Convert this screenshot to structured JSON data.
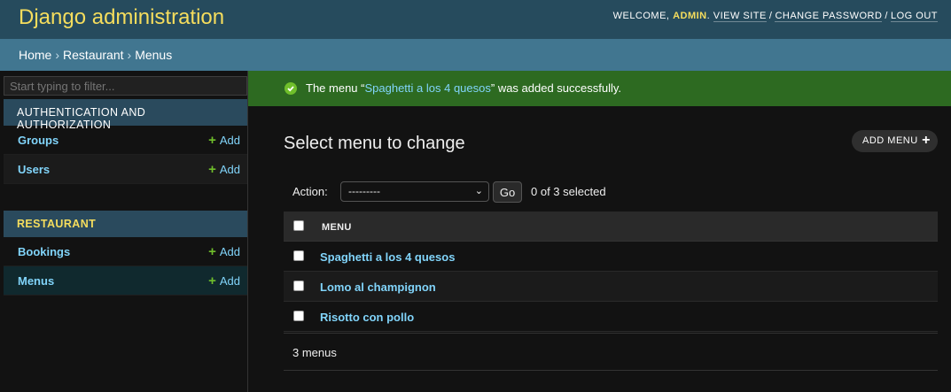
{
  "header": {
    "title": "Django administration",
    "welcome": "Welcome,",
    "username": "admin",
    "view_site": "View site",
    "change_password": "Change password",
    "log_out": "Log out",
    "separator": "/"
  },
  "breadcrumbs": {
    "home": "Home",
    "app": "Restaurant",
    "current": "Menus",
    "separator": "›"
  },
  "sidebar": {
    "filter_placeholder": "Start typing to filter...",
    "modules": [
      {
        "caption": "Authentication and Authorization",
        "models": [
          {
            "name": "Groups",
            "add": "Add"
          },
          {
            "name": "Users",
            "add": "Add"
          }
        ]
      },
      {
        "caption": "Restaurant",
        "models": [
          {
            "name": "Bookings",
            "add": "Add"
          },
          {
            "name": "Menus",
            "add": "Add"
          }
        ]
      }
    ]
  },
  "message": {
    "prefix": "The menu “",
    "link": "Spaghetti a los 4 quesos",
    "suffix": "” was added successfully."
  },
  "content": {
    "title": "Select menu to change",
    "add_button": "Add menu",
    "action_label": "Action:",
    "action_select": "---------",
    "go_button": "Go",
    "selected_count": "0 of 3 selected",
    "column_header": "Menu",
    "rows": [
      "Spaghetti a los 4 quesos",
      "Lomo al champignon",
      "Risotto con pollo"
    ],
    "paginator": "3 menus"
  },
  "colors": {
    "header_bg": "#264b5d",
    "breadcrumbs_bg": "#417690",
    "brand_yellow": "#f5dd5d",
    "link_blue": "#81d4fa",
    "success_green": "#2d6a21",
    "add_green": "#70bf2b"
  },
  "icons": [
    "plus-icon",
    "check-circle-icon",
    "chevron-down-icon"
  ]
}
